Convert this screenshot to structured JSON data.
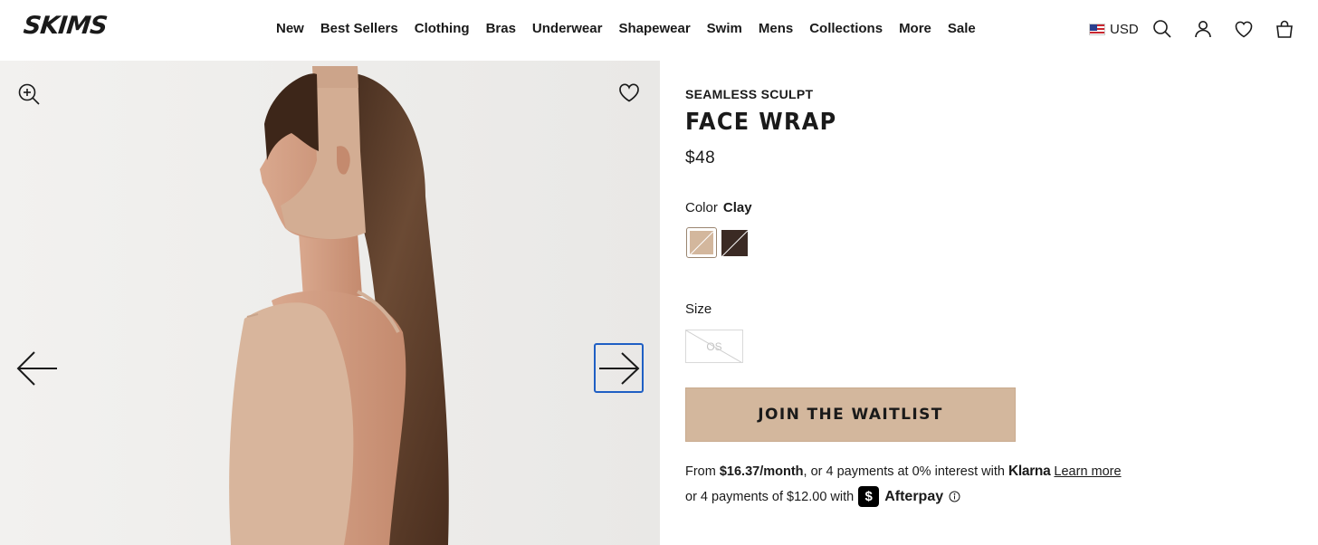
{
  "header": {
    "logo": "SKIMS",
    "nav": [
      "New",
      "Best Sellers",
      "Clothing",
      "Bras",
      "Underwear",
      "Shapewear",
      "Swim",
      "Mens",
      "Collections",
      "More",
      "Sale"
    ],
    "currency": "USD",
    "icons": [
      "flag-us-icon",
      "search-icon",
      "account-icon",
      "wishlist-icon",
      "bag-icon"
    ]
  },
  "gallery": {
    "icons": [
      "zoom-in-icon",
      "heart-icon",
      "arrow-left-icon",
      "arrow-right-icon"
    ]
  },
  "product": {
    "collection": "SEAMLESS SCULPT",
    "title": "FACE WRAP",
    "price": "$48",
    "color_label": "Color",
    "color_value": "Clay",
    "swatches": [
      {
        "name": "Clay",
        "hex": "#d3b79d",
        "selected": true
      },
      {
        "name": "Cocoa",
        "hex": "#3b2a24",
        "selected": false
      }
    ],
    "size_label": "Size",
    "size_option": "OS",
    "cta": "JOIN THE WAITLIST",
    "klarna": {
      "prefix": "From ",
      "amount": "$16.37/month",
      "middle": ", or 4 payments at 0% interest with",
      "brand": "Klarna",
      "link": "Learn more"
    },
    "afterpay": {
      "prefix": "or 4 payments of $12.00 with",
      "badge": "$",
      "brand": "Afterpay"
    }
  },
  "colors": {
    "accent": "#d3b79d",
    "text": "#1a1a1a",
    "focus": "#1f5fc4",
    "gallery_bg": "#efeeec"
  }
}
